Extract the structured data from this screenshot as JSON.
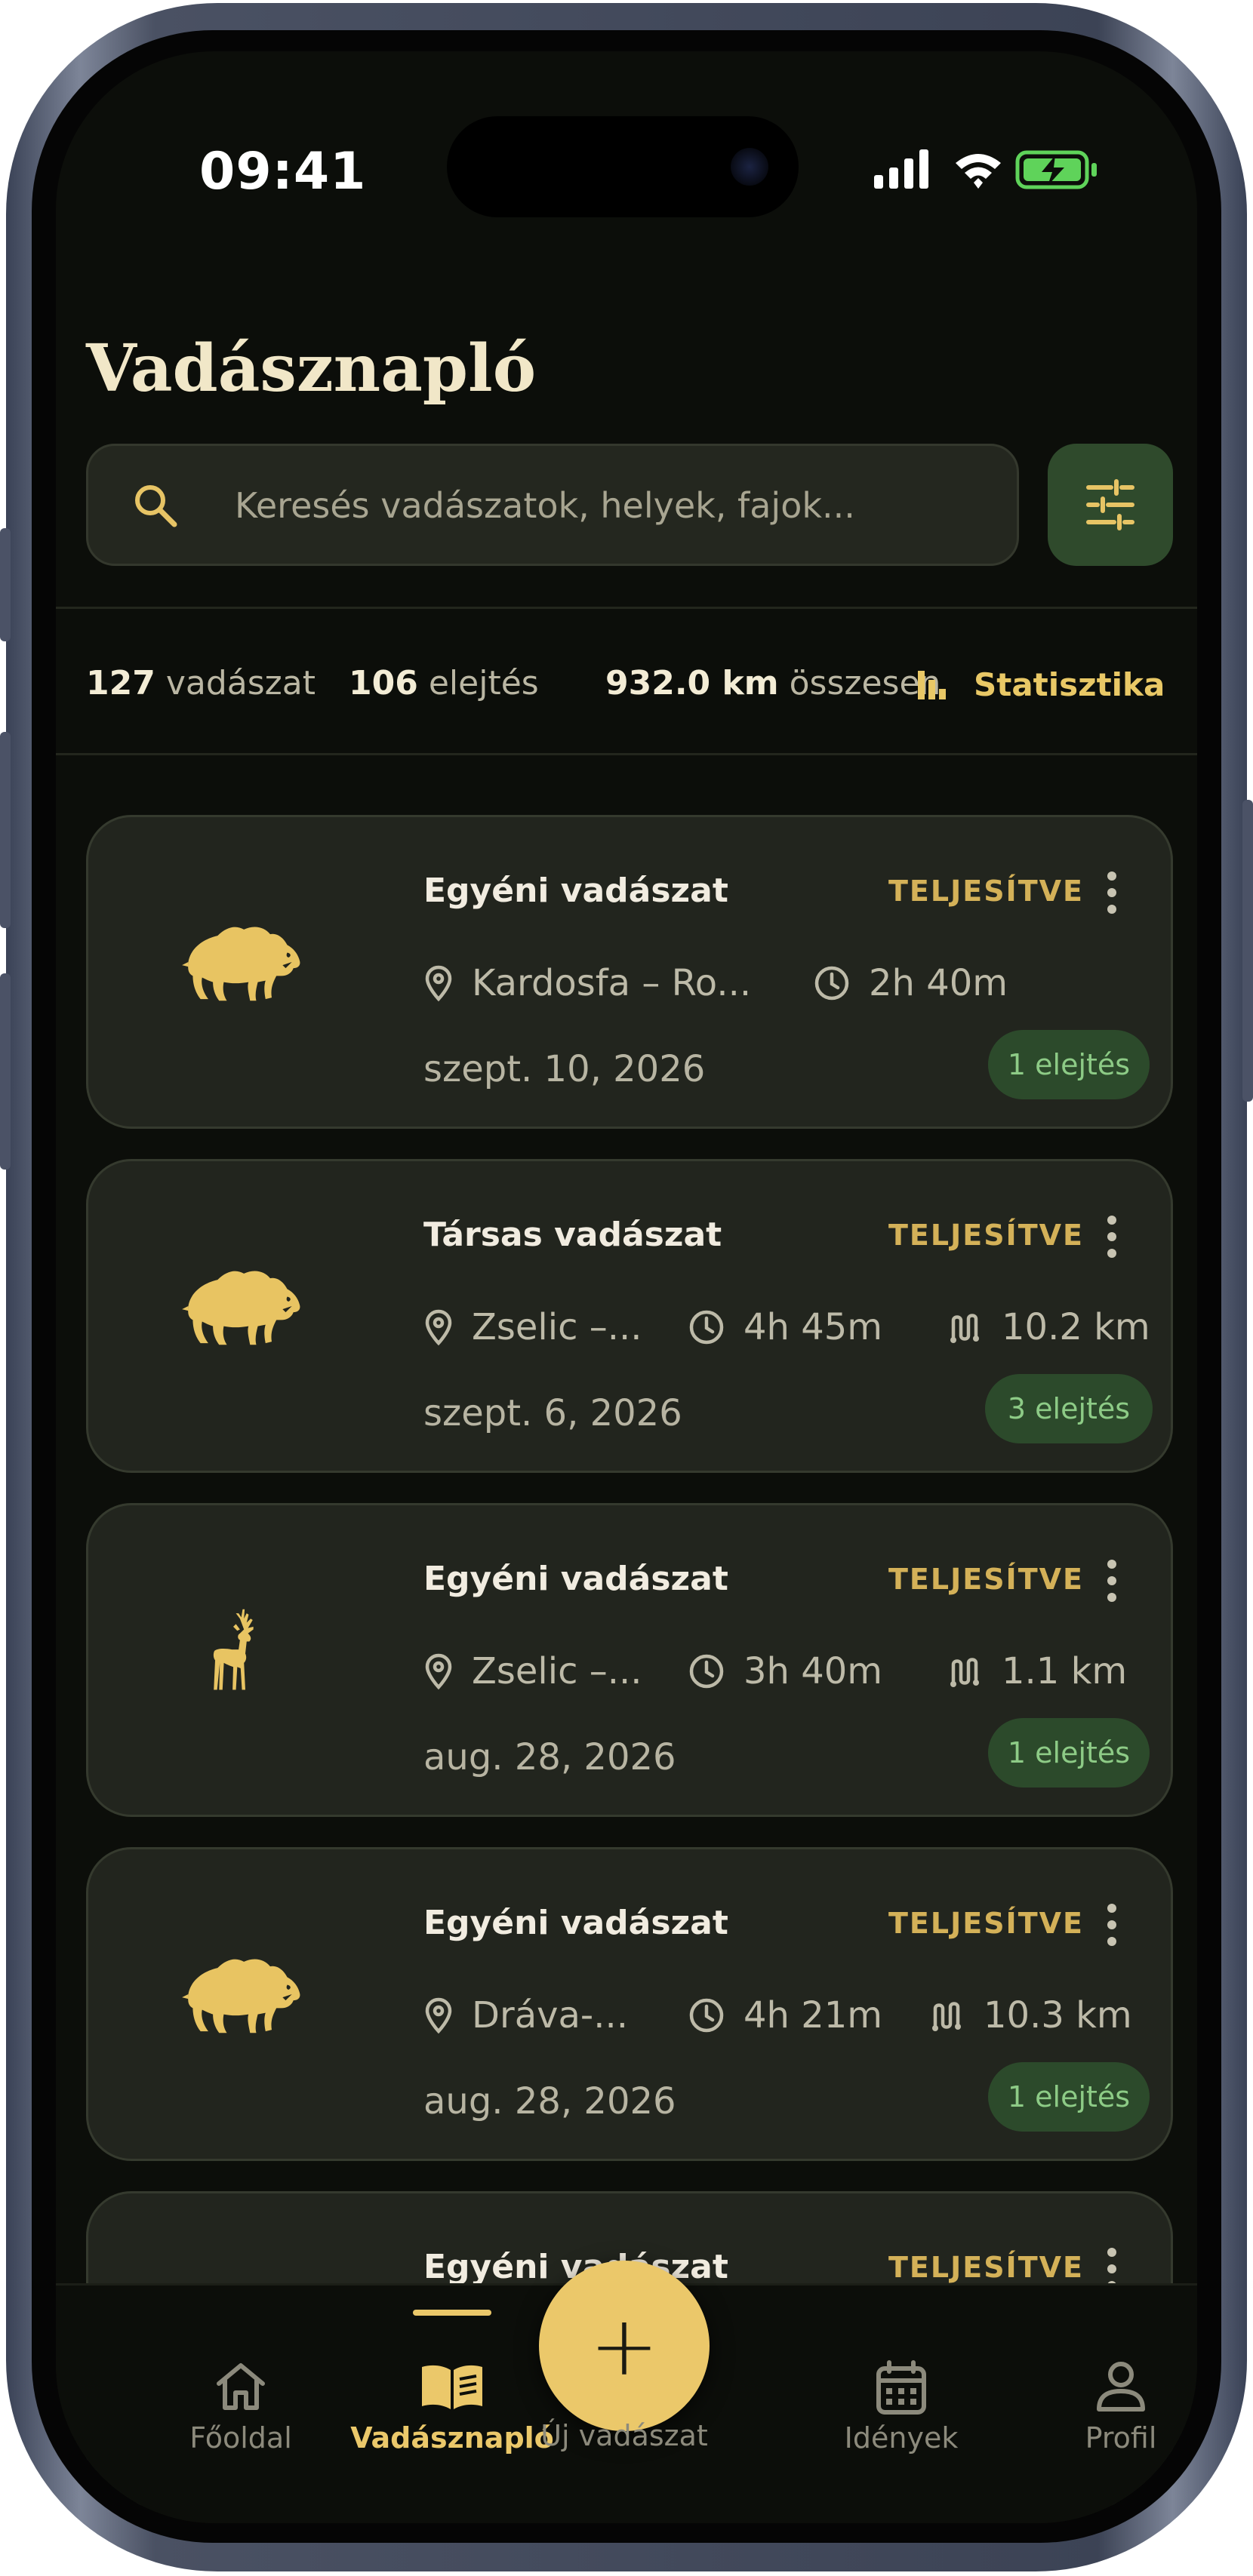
{
  "status_bar": {
    "time": "09:41"
  },
  "header": {
    "title": "Vadásznapló"
  },
  "search": {
    "placeholder": "Keresés vadászatok, helyek, fajok...",
    "value": ""
  },
  "stats": {
    "hunts_count": "127",
    "hunts_label": "vadászat",
    "kills_count": "106",
    "kills_label": "elejtés",
    "distance_value": "932.0 km",
    "distance_label": "összesen",
    "link_label": "Statisztika"
  },
  "cards": [
    {
      "animal": "boar-icon",
      "type": "Egyéni vadászat",
      "status": "TELJESÍTVE",
      "location": "Kardosfa – Ro...",
      "duration": "2h 40m",
      "distance": null,
      "date": "szept. 10, 2026",
      "kills": "1 elejtés"
    },
    {
      "animal": "boar-icon",
      "type": "Társas vadászat",
      "status": "TELJESÍTVE",
      "location": "Zselic –...",
      "duration": "4h 45m",
      "distance": "10.2 km",
      "date": "szept. 6, 2026",
      "kills": "3 elejtés"
    },
    {
      "animal": "deer-icon",
      "type": "Egyéni vadászat",
      "status": "TELJESÍTVE",
      "location": "Zselic –...",
      "duration": "3h 40m",
      "distance": "1.1 km",
      "date": "aug. 28, 2026",
      "kills": "1 elejtés"
    },
    {
      "animal": "boar-icon",
      "type": "Egyéni vadászat",
      "status": "TELJESÍTVE",
      "location": "Dráva-...",
      "duration": "4h 21m",
      "distance": "10.3 km",
      "date": "aug. 28, 2026",
      "kills": "1 elejtés"
    },
    {
      "animal": "boar-icon",
      "type": "Egyéni vadászat",
      "status": "TELJESÍTVE"
    }
  ],
  "nav": {
    "home": "Főoldal",
    "journal": "Vadásznapló",
    "new_hunt": "Új vadászat",
    "seasons": "Idények",
    "profile": "Profil",
    "fab_symbol": "+"
  },
  "colors": {
    "accent": "#ebc86a",
    "background": "#0c0e0a",
    "card": "#22251e",
    "badge_bg": "#2c4a2b",
    "badge_text": "#8dcb86"
  }
}
